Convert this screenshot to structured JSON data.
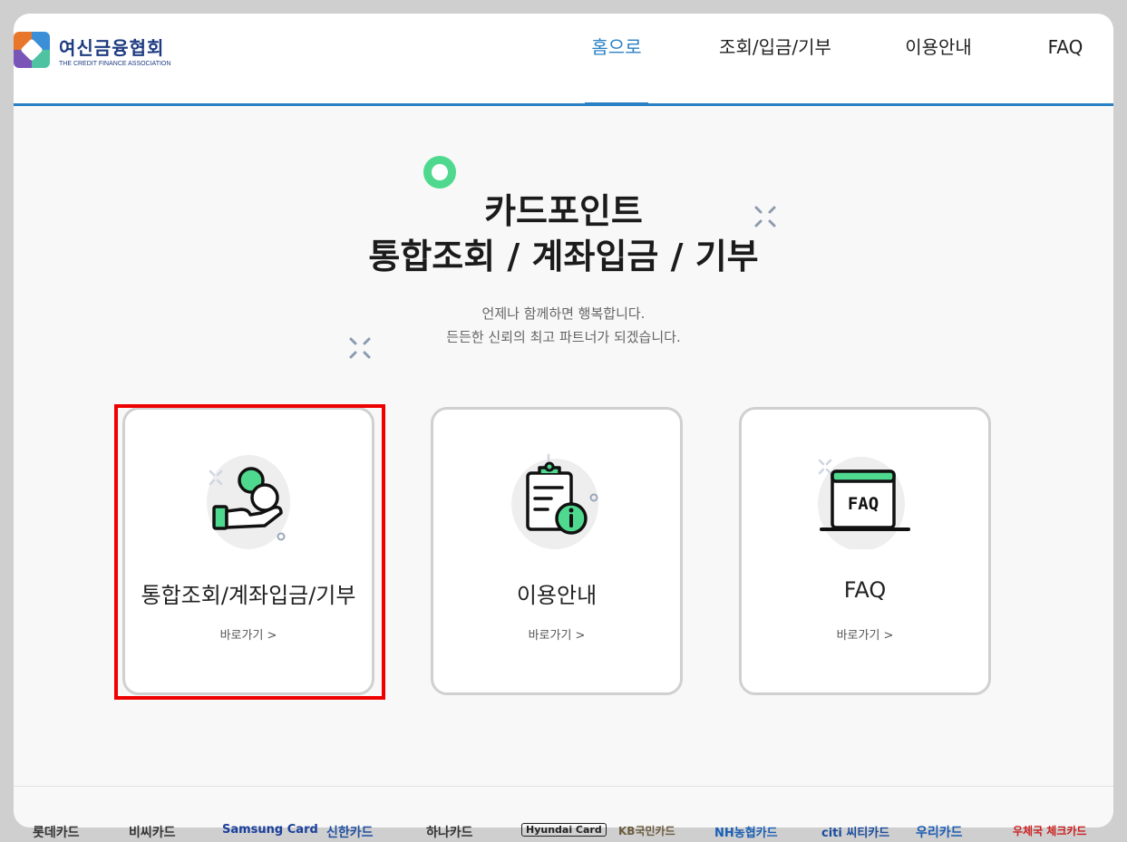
{
  "logo": {
    "name_ko": "여신금융협회",
    "name_en": "THE CREDIT FINANCE ASSOCIATION"
  },
  "nav": [
    {
      "label": "홈으로",
      "active": true
    },
    {
      "label": "조회/입금/기부",
      "active": false
    },
    {
      "label": "이용안내",
      "active": false
    },
    {
      "label": "FAQ",
      "active": false
    }
  ],
  "hero": {
    "title_line1": "카드포인트",
    "title_line2": "통합조회 / 계좌입금 / 기부",
    "subtitle_line1": "언제나 함께하면 행복합니다.",
    "subtitle_line2": "든든한 신뢰의 최고 파트너가 되겠습니다."
  },
  "cards": [
    {
      "title": "통합조회/계좌입금/기부",
      "link": "바로가기 >",
      "icon": "hand-coins-icon",
      "highlighted": true
    },
    {
      "title": "이용안내",
      "link": "바로가기 >",
      "icon": "clipboard-info-icon",
      "highlighted": false
    },
    {
      "title": "FAQ",
      "link": "바로가기 >",
      "icon": "faq-window-icon",
      "highlighted": false
    }
  ],
  "brands": [
    {
      "label": "롯데카드",
      "color": "#333333"
    },
    {
      "label": "비씨카드",
      "color": "#333333"
    },
    {
      "label": "Samsung Card",
      "color": "#1a3f9c"
    },
    {
      "label": "신한카드",
      "color": "#1f4fa0"
    },
    {
      "label": "하나카드",
      "color": "#333333"
    },
    {
      "label": "Hyundai Card",
      "color": "#222222"
    },
    {
      "label": "KB국민카드",
      "color": "#6b5c3e"
    },
    {
      "label": "NH농협카드",
      "color": "#1a5fb4"
    },
    {
      "label": "citi 씨티카드",
      "color": "#1a4c9c"
    },
    {
      "label": "우리카드",
      "color": "#1a5cb4"
    },
    {
      "label": "우체국 체크카드",
      "color": "#cc1f1f"
    }
  ],
  "colors": {
    "accent": "#2a80c4",
    "green": "#4fd98f",
    "highlight": "#ee0000"
  }
}
